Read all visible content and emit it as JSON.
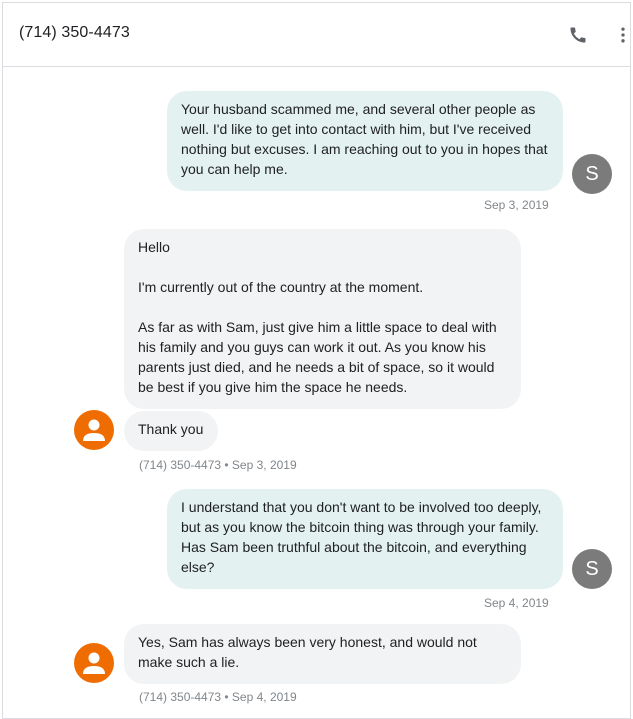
{
  "header": {
    "title": "(714) 350-4473",
    "call_icon": "phone-icon",
    "more_icon": "more-vert-icon"
  },
  "messages": [
    {
      "direction": "outgoing",
      "text": "Your husband scammed me, and several other people as well. I'd like to get into contact with him, but I've received nothing but excuses. I am reaching out to you in hopes that you can help me.",
      "avatar_letter": "S",
      "timestamp": "Sep 3, 2019"
    },
    {
      "direction": "incoming",
      "text": "Hello\n\nI'm currently out of the country at the moment.\n\nAs far as with Sam, just give him a little space to deal with his family and you guys can work it out. As you know his parents just died, and he needs a bit of space, so it would be best if you give him the space he needs."
    },
    {
      "direction": "incoming",
      "text": "Thank you",
      "timestamp": "(714) 350-4473 • Sep 3, 2019"
    },
    {
      "direction": "outgoing",
      "text": "I understand that you don't want to be involved too deeply, but as you know the bitcoin thing was through your family. Has Sam been truthful about the bitcoin, and everything else?",
      "avatar_letter": "S",
      "timestamp": "Sep 4, 2019"
    },
    {
      "direction": "incoming",
      "text": "Yes, Sam has always been very honest, and would not make such a lie.",
      "timestamp": "(714) 350-4473 • Sep 4, 2019"
    }
  ],
  "colors": {
    "outgoing_bubble": "#e3f2f0",
    "incoming_bubble": "#f1f3f4",
    "self_avatar": "#7b7b7b",
    "contact_avatar": "#ef6c00",
    "timestamp": "#80868b"
  }
}
